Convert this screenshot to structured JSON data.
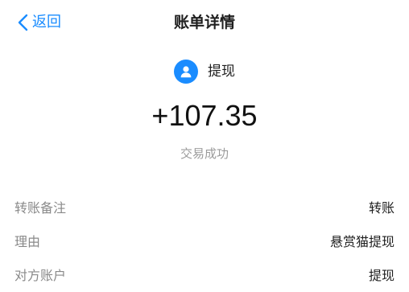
{
  "nav": {
    "back_label": "返回",
    "title": "账单详情"
  },
  "summary": {
    "type_icon": "user-avatar-icon",
    "type_label": "提现",
    "amount": "+107.35",
    "status": "交易成功"
  },
  "details": [
    {
      "label": "转账备注",
      "value": "转账"
    },
    {
      "label": "理由",
      "value": "悬赏猫提现"
    },
    {
      "label": "对方账户",
      "value": "提现"
    }
  ],
  "colors": {
    "accent": "#1a8cff",
    "muted_text": "#9b9b9b",
    "label_text": "#8a8a8a"
  }
}
